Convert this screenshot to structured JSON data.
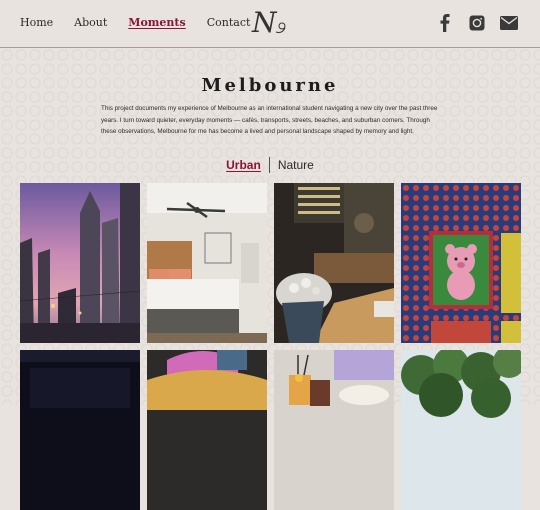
{
  "nav": {
    "items": [
      {
        "label": "Home",
        "active": false
      },
      {
        "label": "About",
        "active": false
      },
      {
        "label": "Moments",
        "active": true
      },
      {
        "label": "Contact",
        "active": false
      }
    ]
  },
  "logo": {
    "text": "N"
  },
  "social": {
    "icons": [
      "facebook-icon",
      "instagram-icon",
      "mail-icon"
    ]
  },
  "page": {
    "title": "Melbourne",
    "description": "This project documents my experience of Melbourne as an international student navigating a new city over the past three years. I turn toward quieter, everyday moments — cafés, transports, streets, beaches, and suburban corners. Through these observations, Melbourne for me has become a lived and personal landscape shaped by memory and light."
  },
  "tabs": [
    {
      "label": "Urban",
      "active": true
    },
    {
      "label": "Nature",
      "active": false
    }
  ],
  "colors": {
    "accent": "#8a1538",
    "background": "#e9e3df",
    "text": "#2a2a2a"
  },
  "gallery": {
    "photos": [
      {
        "name": "city-skyline-sunset"
      },
      {
        "name": "hotel-bedroom"
      },
      {
        "name": "cafe-interior-flowers"
      },
      {
        "name": "pink-bear-poster-wall"
      },
      {
        "name": "dark-street-night"
      },
      {
        "name": "taco-food"
      },
      {
        "name": "cafe-drinks-table"
      },
      {
        "name": "green-trees"
      }
    ]
  }
}
